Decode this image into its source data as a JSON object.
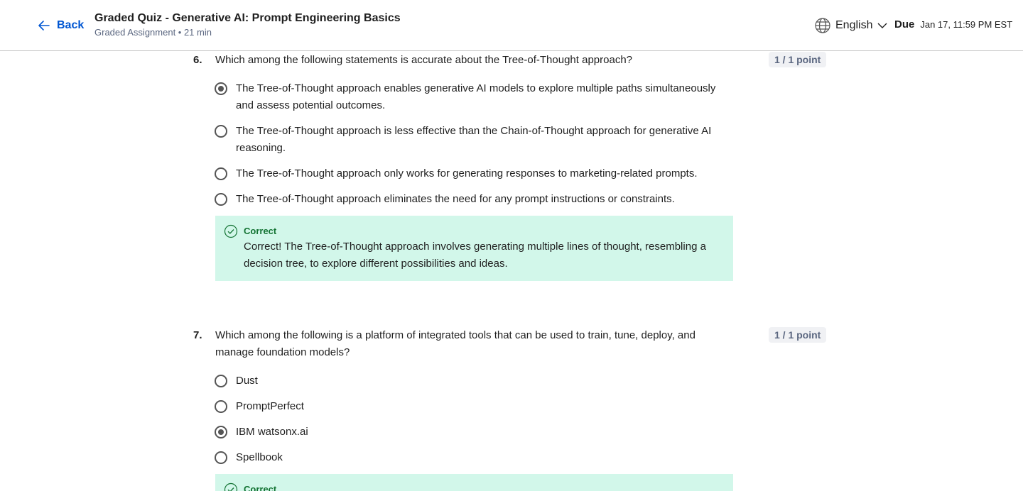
{
  "header": {
    "back_label": "Back",
    "title": "Graded Quiz - Generative AI: Prompt Engineering Basics",
    "subtitle": "Graded Assignment • 21 min",
    "language": "English",
    "due_label": "Due",
    "due_date": "Jan 17, 11:59 PM EST"
  },
  "questions": [
    {
      "number": "6.",
      "text": "Which among the following statements is accurate about the Tree-of-Thought approach?",
      "points": "1 / 1 point",
      "options": [
        {
          "label": "The Tree-of-Thought approach enables generative AI models to explore multiple paths simultaneously and assess potential outcomes.",
          "selected": true
        },
        {
          "label": "The Tree-of-Thought approach is less effective than the Chain-of-Thought approach for generative AI reasoning.",
          "selected": false
        },
        {
          "label": "The Tree-of-Thought approach only works for generating responses to marketing-related prompts.",
          "selected": false
        },
        {
          "label": "The Tree-of-Thought approach eliminates the need for any prompt instructions or constraints.",
          "selected": false
        }
      ],
      "feedback": {
        "title": "Correct",
        "text": "Correct! The Tree-of-Thought approach involves generating multiple lines of thought, resembling a decision tree, to explore different possibilities and ideas."
      }
    },
    {
      "number": "7.",
      "text": "Which among the following is a platform of integrated tools that can be used to train, tune, deploy, and manage foundation models?",
      "points": "1 / 1 point",
      "options": [
        {
          "label": "Dust",
          "selected": false
        },
        {
          "label": "PromptPerfect",
          "selected": false
        },
        {
          "label": "IBM watsonx.ai",
          "selected": true
        },
        {
          "label": "Spellbook",
          "selected": false
        }
      ],
      "feedback": {
        "title": "Correct"
      }
    }
  ],
  "colors": {
    "accent": "#0056d2",
    "correct_bg": "#d2f7ea",
    "correct_text": "#137333"
  }
}
